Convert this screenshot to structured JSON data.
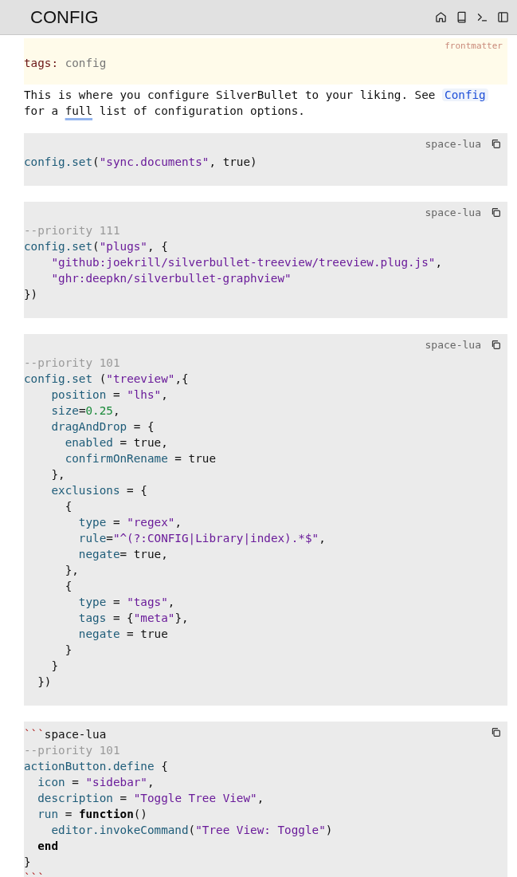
{
  "header": {
    "title": "CONFIG"
  },
  "frontmatter": {
    "label": "frontmatter",
    "key": "tags:",
    "value": "config"
  },
  "paragraph": [
    {
      "kind": "text",
      "text": "This is where you configure SilverBullet to your liking. See "
    },
    {
      "kind": "link",
      "text": "Config"
    },
    {
      "kind": "text",
      "text": " for a "
    },
    {
      "kind": "underline",
      "text": "full"
    },
    {
      "kind": "text",
      "text": " list of configuration options."
    }
  ],
  "blocks": [
    {
      "label": "space-lua",
      "lines": [
        [
          {
            "kind": "v",
            "text": "config"
          },
          {
            "kind": "v",
            "text": ".set"
          },
          {
            "kind": "p",
            "text": "("
          },
          {
            "kind": "s",
            "text": "\"sync.documents\""
          },
          {
            "kind": "p",
            "text": ", true)"
          }
        ]
      ]
    },
    {
      "label": "space-lua",
      "lines": [
        [
          {
            "kind": "c",
            "text": "--priority 111"
          }
        ],
        [
          {
            "kind": "v",
            "text": "config"
          },
          {
            "kind": "v",
            "text": ".set"
          },
          {
            "kind": "p",
            "text": "("
          },
          {
            "kind": "s",
            "text": "\"plugs\""
          },
          {
            "kind": "p",
            "text": ", {"
          }
        ],
        [
          {
            "kind": "s",
            "text": "    \"github:joekrill/silverbullet-treeview/treeview.plug.js\""
          },
          {
            "kind": "p",
            "text": ","
          }
        ],
        [
          {
            "kind": "s",
            "text": "    \"ghr:deepkn/silverbullet-graphview\""
          }
        ],
        [
          {
            "kind": "p",
            "text": "})"
          }
        ]
      ]
    },
    {
      "label": "space-lua",
      "lines": [
        [
          {
            "kind": "c",
            "text": "--priority 101"
          }
        ],
        [
          {
            "kind": "v",
            "text": "config"
          },
          {
            "kind": "v",
            "text": ".set"
          },
          {
            "kind": "p",
            "text": " ("
          },
          {
            "kind": "s",
            "text": "\"treeview\""
          },
          {
            "kind": "p",
            "text": ",{"
          }
        ],
        [
          {
            "kind": "v",
            "text": "    position"
          },
          {
            "kind": "p",
            "text": " = "
          },
          {
            "kind": "s",
            "text": "\"lhs\""
          },
          {
            "kind": "p",
            "text": ","
          }
        ],
        [
          {
            "kind": "v",
            "text": "    size"
          },
          {
            "kind": "p",
            "text": "="
          },
          {
            "kind": "n",
            "text": "0.25"
          },
          {
            "kind": "p",
            "text": ","
          }
        ],
        [
          {
            "kind": "v",
            "text": "    dragAndDrop"
          },
          {
            "kind": "p",
            "text": " = {"
          }
        ],
        [
          {
            "kind": "v",
            "text": "      enabled"
          },
          {
            "kind": "p",
            "text": " = true,"
          }
        ],
        [
          {
            "kind": "v",
            "text": "      confirmOnRename"
          },
          {
            "kind": "p",
            "text": " = true"
          }
        ],
        [
          {
            "kind": "p",
            "text": "    },"
          }
        ],
        [
          {
            "kind": "v",
            "text": "    exclusions"
          },
          {
            "kind": "p",
            "text": " = {"
          }
        ],
        [
          {
            "kind": "p",
            "text": "      {"
          }
        ],
        [
          {
            "kind": "v",
            "text": "        type"
          },
          {
            "kind": "p",
            "text": " = "
          },
          {
            "kind": "s",
            "text": "\"regex\""
          },
          {
            "kind": "p",
            "text": ","
          }
        ],
        [
          {
            "kind": "v",
            "text": "        rule"
          },
          {
            "kind": "p",
            "text": "="
          },
          {
            "kind": "s",
            "text": "\"^(?:CONFIG|Library|index).*$\""
          },
          {
            "kind": "p",
            "text": ","
          }
        ],
        [
          {
            "kind": "v",
            "text": "        negate"
          },
          {
            "kind": "p",
            "text": "= true,"
          }
        ],
        [
          {
            "kind": "p",
            "text": "      },"
          }
        ],
        [
          {
            "kind": "p",
            "text": "      {"
          }
        ],
        [
          {
            "kind": "v",
            "text": "        type"
          },
          {
            "kind": "p",
            "text": " = "
          },
          {
            "kind": "s",
            "text": "\"tags\""
          },
          {
            "kind": "p",
            "text": ","
          }
        ],
        [
          {
            "kind": "v",
            "text": "        tags"
          },
          {
            "kind": "p",
            "text": " = {"
          },
          {
            "kind": "s",
            "text": "\"meta\""
          },
          {
            "kind": "p",
            "text": "},"
          }
        ],
        [
          {
            "kind": "v",
            "text": "        negate"
          },
          {
            "kind": "p",
            "text": " = true"
          }
        ],
        [
          {
            "kind": "p",
            "text": "      }"
          }
        ],
        [
          {
            "kind": "p",
            "text": "    }"
          }
        ],
        [
          {
            "kind": "p",
            "text": "  })"
          }
        ]
      ]
    },
    {
      "lines": [
        [
          {
            "kind": "f",
            "text": "```"
          },
          {
            "kind": "p",
            "text": "space-lua"
          }
        ],
        [
          {
            "kind": "c",
            "text": "--priority 101"
          }
        ],
        [
          {
            "kind": "v",
            "text": "actionButton"
          },
          {
            "kind": "v",
            "text": ".define"
          },
          {
            "kind": "p",
            "text": " {"
          }
        ],
        [
          {
            "kind": "v",
            "text": "  icon"
          },
          {
            "kind": "p",
            "text": " = "
          },
          {
            "kind": "s",
            "text": "\"sidebar\""
          },
          {
            "kind": "p",
            "text": ","
          }
        ],
        [
          {
            "kind": "v",
            "text": "  description"
          },
          {
            "kind": "p",
            "text": " = "
          },
          {
            "kind": "s",
            "text": "\"Toggle Tree View\""
          },
          {
            "kind": "p",
            "text": ","
          }
        ],
        [
          {
            "kind": "v",
            "text": "  run"
          },
          {
            "kind": "p",
            "text": " = "
          },
          {
            "kind": "k",
            "text": "function"
          },
          {
            "kind": "p",
            "text": "()"
          }
        ],
        [
          {
            "kind": "v",
            "text": "    editor"
          },
          {
            "kind": "v",
            "text": ".invokeCommand"
          },
          {
            "kind": "p",
            "text": "("
          },
          {
            "kind": "s",
            "text": "\"Tree View: Toggle\""
          },
          {
            "kind": "p",
            "text": ")"
          }
        ],
        [
          {
            "kind": "k",
            "text": "  end"
          }
        ],
        [
          {
            "kind": "p",
            "text": "}"
          }
        ],
        [
          {
            "kind": "f",
            "text": "```"
          }
        ]
      ]
    }
  ]
}
